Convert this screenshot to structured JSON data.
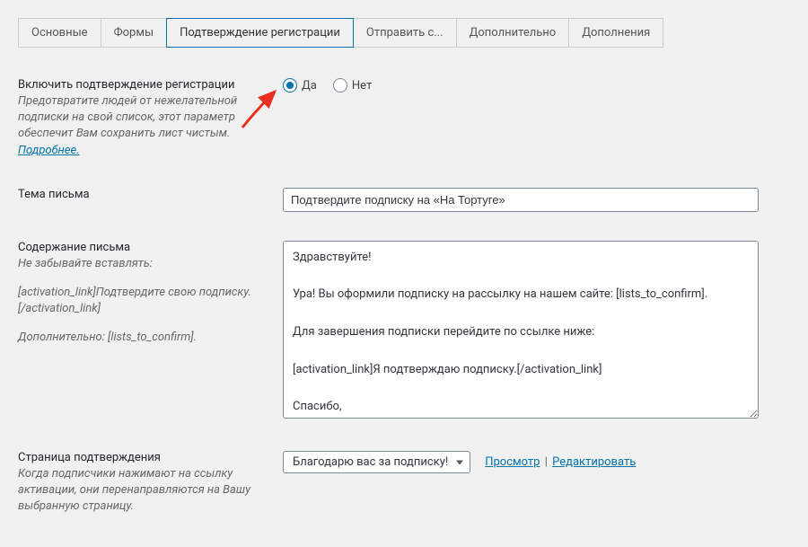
{
  "tabs": {
    "items": [
      {
        "label": "Основные",
        "active": false
      },
      {
        "label": "Формы",
        "active": false
      },
      {
        "label": "Подтверждение регистрации",
        "active": true
      },
      {
        "label": "Отправить с...",
        "active": false
      },
      {
        "label": "Дополнительно",
        "active": false
      },
      {
        "label": "Дополнения",
        "active": false
      }
    ]
  },
  "enable_confirm": {
    "title": "Включить подтверждение регистрации",
    "desc": "Предотвратите людей от нежелательной подписки на свой список, этот параметр обеспечит Вам сохранить лист чистым.",
    "more": "Подробнее.",
    "yes": "Да",
    "no": "Нет"
  },
  "subject": {
    "title": "Тема письма",
    "value": "Подтвердите подписку на «На Тортуге»"
  },
  "content": {
    "title": "Содержание письма",
    "desc": "Не забывайте вставлять:",
    "extra1": "[activation_link]Подтвердите свою подписку.[/activation_link]",
    "extra2": "Дополнительно: [lists_to_confirm].",
    "value": "Здравствуйте!\n\nУра! Вы оформили подписку на рассылку на нашем сайте: [lists_to_confirm].\n\nДля завершения подписки перейдите по ссылке ниже:\n\n[activation_link]Я подтверждаю подписку.[/activation_link]\n\nСпасибо,\nКоманда сайта"
  },
  "confirm_page": {
    "title": "Страница подтверждения",
    "desc": "Когда подписчики нажимают на ссылку активации, они перенаправляются на Вашу выбранную страницу.",
    "selected": "Благодарю вас за подписку!",
    "preview": "Просмотр",
    "edit": "Редактировать"
  }
}
